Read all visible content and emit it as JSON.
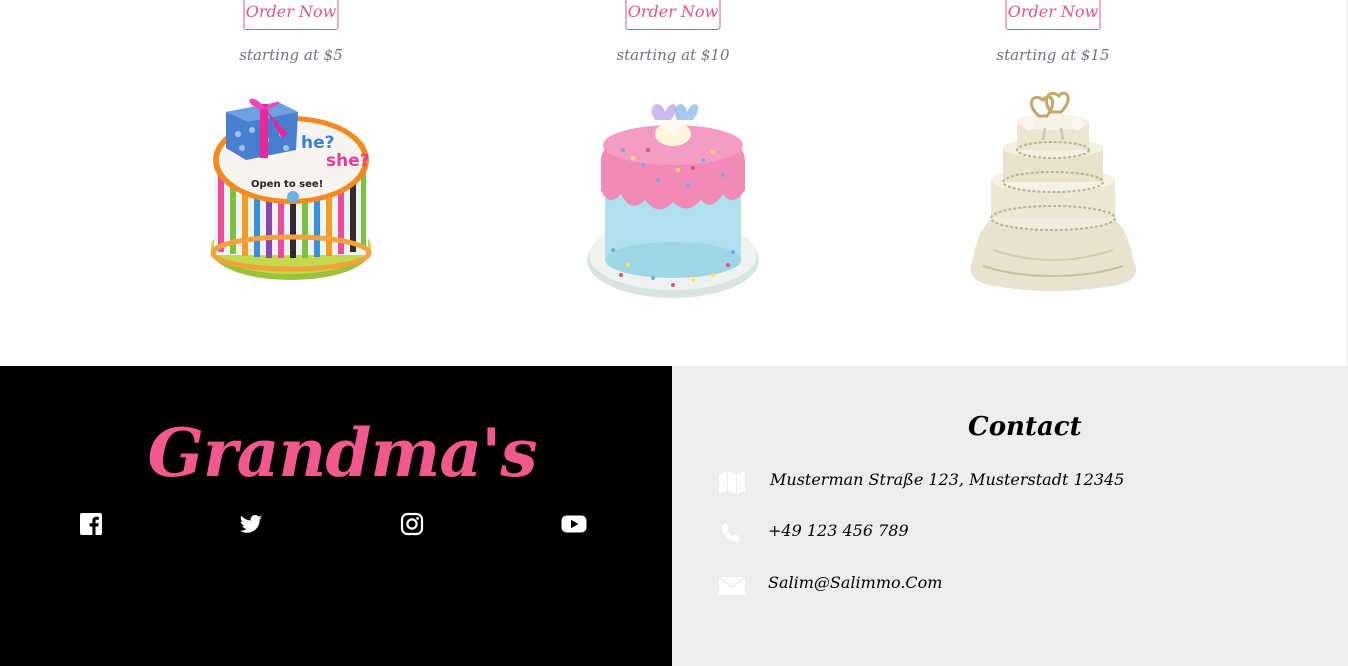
{
  "products": [
    {
      "order_label": "Order Now",
      "price": "starting at $5",
      "image": "gender-reveal-striped-cake",
      "cake_text_1": "he?",
      "cake_text_2": "she?",
      "cake_text_3": "Open to see!"
    },
    {
      "order_label": "Order Now",
      "price": "starting at $10",
      "image": "pink-sprinkle-frosted-cake"
    },
    {
      "order_label": "Order Now",
      "price": "starting at $15",
      "image": "three-tier-wedding-cake"
    }
  ],
  "footer": {
    "brand": "Grandma's",
    "social": [
      {
        "icon": "facebook-icon"
      },
      {
        "icon": "twitter-icon"
      },
      {
        "icon": "instagram-icon"
      },
      {
        "icon": "youtube-icon"
      }
    ],
    "contact": {
      "title": "Contact",
      "address": "Musterman Straße 123, Musterstadt 12345",
      "phone": "+49 123 456 789",
      "email": "Salim@Salimmo.Com"
    }
  },
  "colors": {
    "accent": "#f0588f",
    "button_border": "#e0558a",
    "price_text": "#6e7480",
    "footer_dark": "#000000",
    "footer_light": "#ededed"
  }
}
